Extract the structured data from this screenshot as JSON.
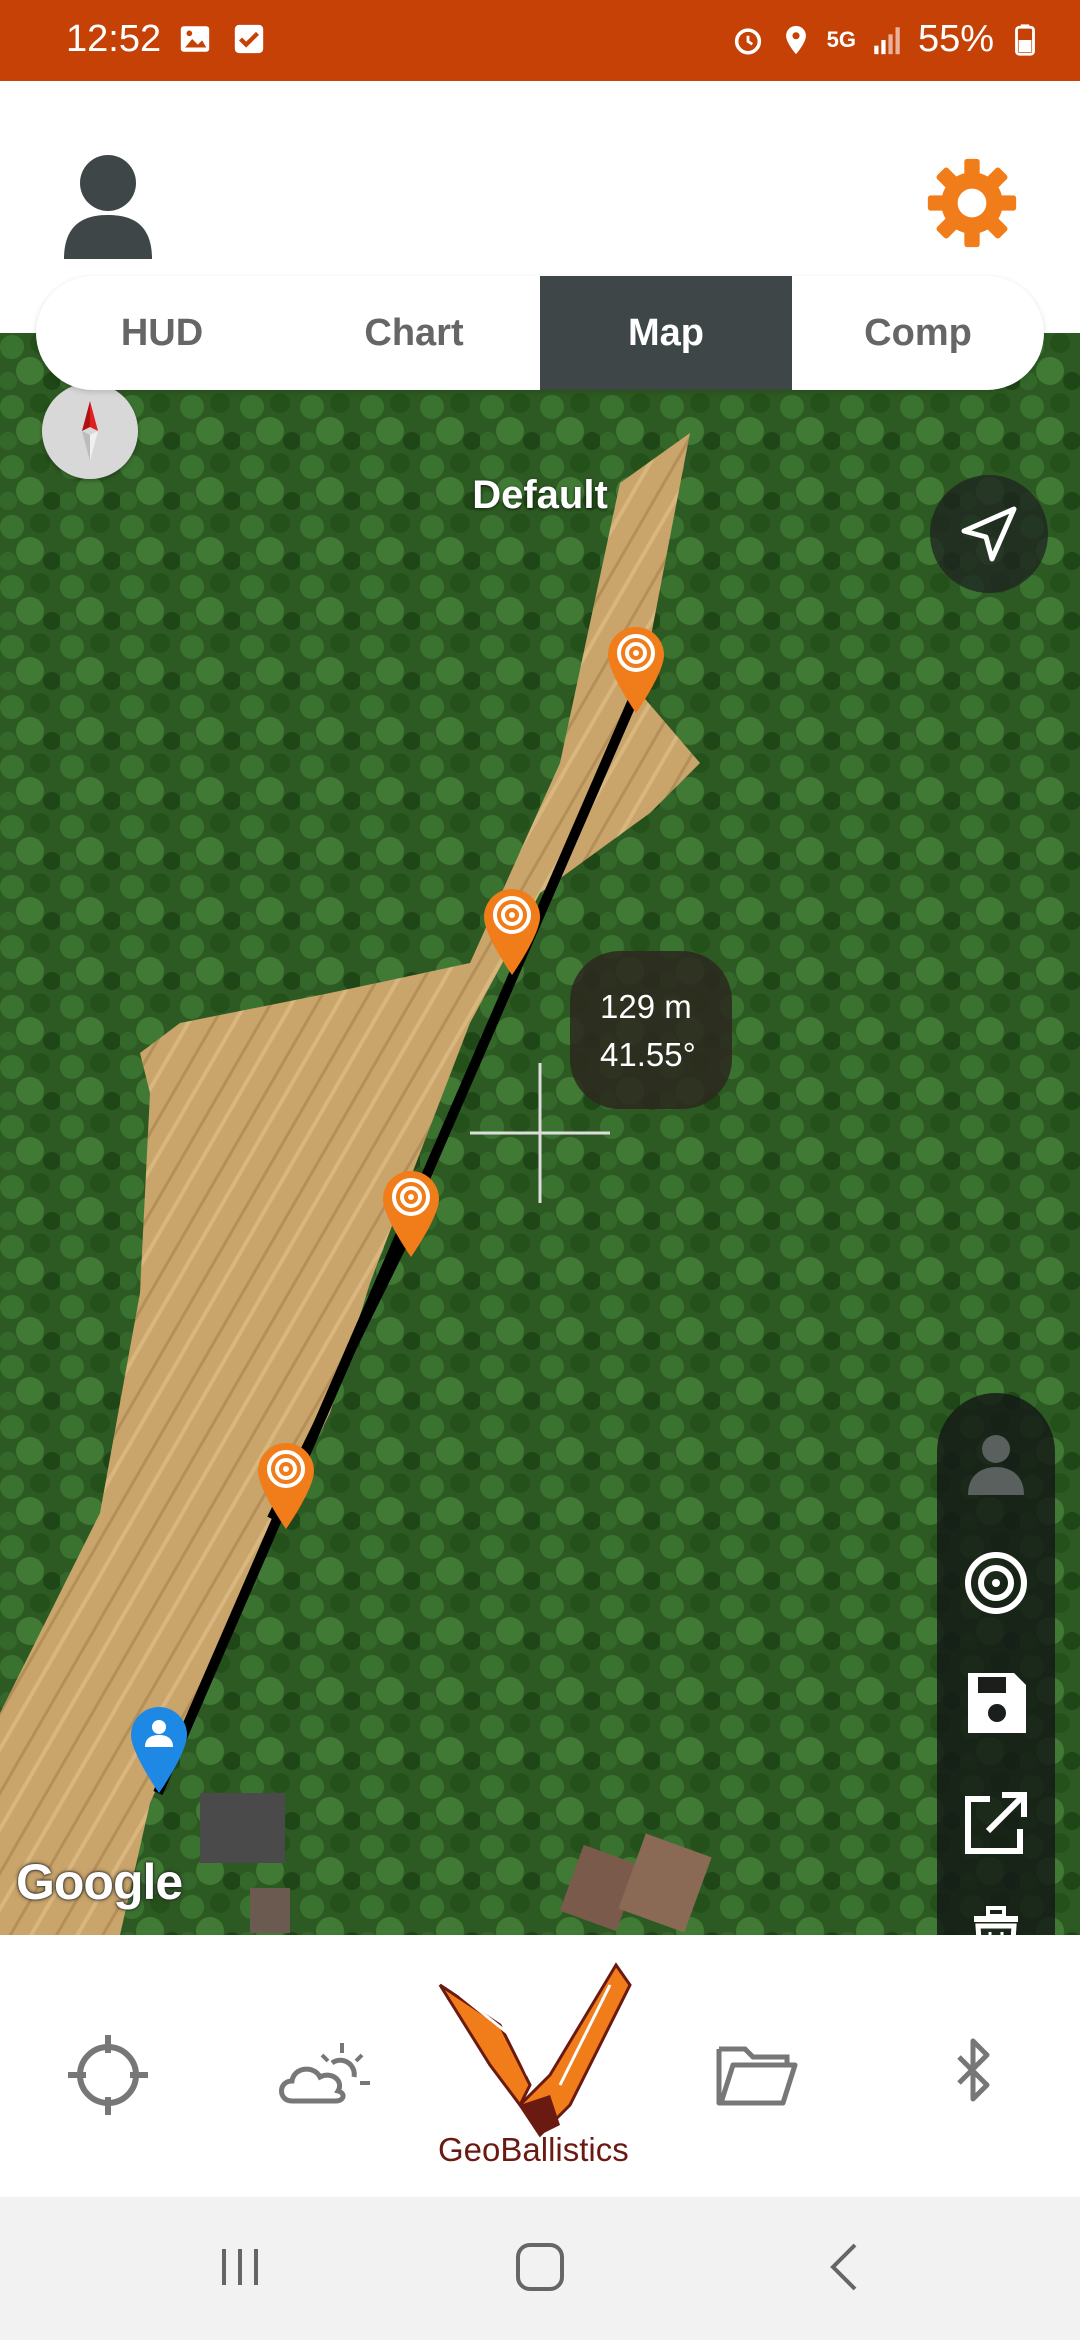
{
  "status_bar": {
    "time": "12:52",
    "network": "5G",
    "battery": "55%",
    "background": "#c64106"
  },
  "tabs": [
    {
      "label": "HUD",
      "active": false
    },
    {
      "label": "Chart",
      "active": false
    },
    {
      "label": "Map",
      "active": true
    },
    {
      "label": "Comp",
      "active": false
    }
  ],
  "map": {
    "profile_name": "Default",
    "distance": "129 m",
    "angle": "41.55°",
    "attribution": "Google",
    "target_pins": 4,
    "shooter_pin": "blue"
  },
  "toolbar": {
    "items": [
      "profile-icon",
      "target-icon",
      "save-icon",
      "share-icon",
      "trash-icon",
      "map-layers-icon",
      "search-icon"
    ]
  },
  "bottom_nav": {
    "items": [
      "crosshair-icon",
      "weather-icon",
      "folder-icon",
      "bluetooth-icon"
    ],
    "logo_text": "GeoBallistics"
  },
  "colors": {
    "accent_orange": "#f07c1a",
    "tab_active": "#3f4647",
    "pin_blue": "#1e88e5"
  }
}
